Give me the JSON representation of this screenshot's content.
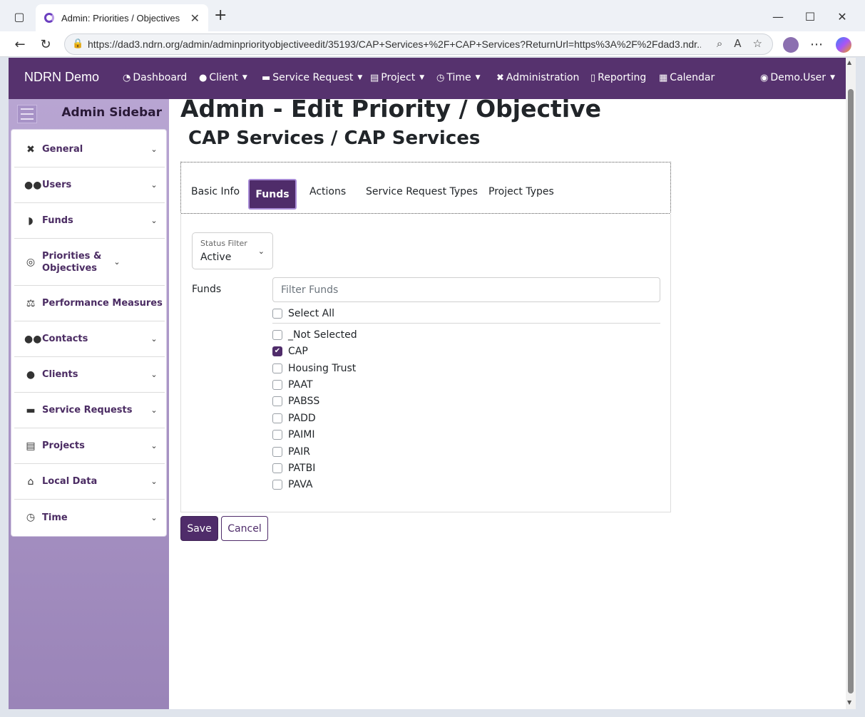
{
  "browser": {
    "tab_title": "Admin: Priorities / Objectives",
    "url": "https://dad3.ndrn.org/admin/adminpriorityobjectiveedit/35193/CAP+Services+%2F+CAP+Services?ReturnUrl=https%3A%2F%2Fdad3.ndr..."
  },
  "navbar": {
    "brand": "NDRN Demo",
    "items": [
      {
        "label": "Dashboard",
        "icon": "dashboard-icon",
        "caret": false
      },
      {
        "label": "Client",
        "icon": "user-icon",
        "caret": true
      },
      {
        "label": "Service Request",
        "icon": "briefcase-icon",
        "caret": true
      },
      {
        "label": "Project",
        "icon": "clipboard-icon",
        "caret": true
      },
      {
        "label": "Time",
        "icon": "clock-icon",
        "caret": true
      },
      {
        "label": "Administration",
        "icon": "tools-icon",
        "caret": false
      },
      {
        "label": "Reporting",
        "icon": "file-icon",
        "caret": false
      },
      {
        "label": "Calendar",
        "icon": "calendar-icon",
        "caret": false
      }
    ],
    "user": "Demo.User"
  },
  "sidebar": {
    "title": "Admin Sidebar",
    "items": [
      {
        "label": "General",
        "icon": "tools-icon",
        "expandable": true
      },
      {
        "label": "Users",
        "icon": "users-icon",
        "expandable": true
      },
      {
        "label": "Funds",
        "icon": "money-bag-icon",
        "expandable": true
      },
      {
        "label": "Priorities & Objectives",
        "icon": "target-icon",
        "expandable": true
      },
      {
        "label": "Performance Measures",
        "icon": "scale-icon",
        "expandable": false
      },
      {
        "label": "Contacts",
        "icon": "users-icon",
        "expandable": true
      },
      {
        "label": "Clients",
        "icon": "user-icon",
        "expandable": true
      },
      {
        "label": "Service Requests",
        "icon": "briefcase-icon",
        "expandable": true
      },
      {
        "label": "Projects",
        "icon": "clipboard-icon",
        "expandable": true
      },
      {
        "label": "Local Data",
        "icon": "house-icon",
        "expandable": true
      },
      {
        "label": "Time",
        "icon": "clock-icon",
        "expandable": true
      }
    ]
  },
  "page": {
    "title": "Admin - Edit Priority / Objective",
    "subtitle": "CAP Services / CAP Services"
  },
  "tabs": {
    "basic_info": "Basic Info",
    "funds": "Funds",
    "actions": "Actions",
    "service_request_types": "Service Request Types",
    "project_types": "Project Types",
    "active_tab": "Funds"
  },
  "funds_form": {
    "status_filter_label": "Status Filter",
    "status_filter_value": "Active",
    "funds_label": "Funds",
    "filter_placeholder": "Filter Funds",
    "select_all_label": "Select All",
    "options": [
      {
        "label": "_Not Selected",
        "checked": false
      },
      {
        "label": "CAP",
        "checked": true
      },
      {
        "label": "Housing Trust",
        "checked": false
      },
      {
        "label": "PAAT",
        "checked": false
      },
      {
        "label": "PABSS",
        "checked": false
      },
      {
        "label": "PADD",
        "checked": false
      },
      {
        "label": "PAIMI",
        "checked": false
      },
      {
        "label": "PAIR",
        "checked": false
      },
      {
        "label": "PATBI",
        "checked": false
      },
      {
        "label": "PAVA",
        "checked": false
      }
    ]
  },
  "buttons": {
    "save": "Save",
    "cancel": "Cancel"
  },
  "colors": {
    "brand_purple": "#56326e",
    "accent_purple": "#4f2c6a",
    "sidebar_gradient_top": "#b8a5d2",
    "sidebar_gradient_bottom": "#9a84b8"
  }
}
